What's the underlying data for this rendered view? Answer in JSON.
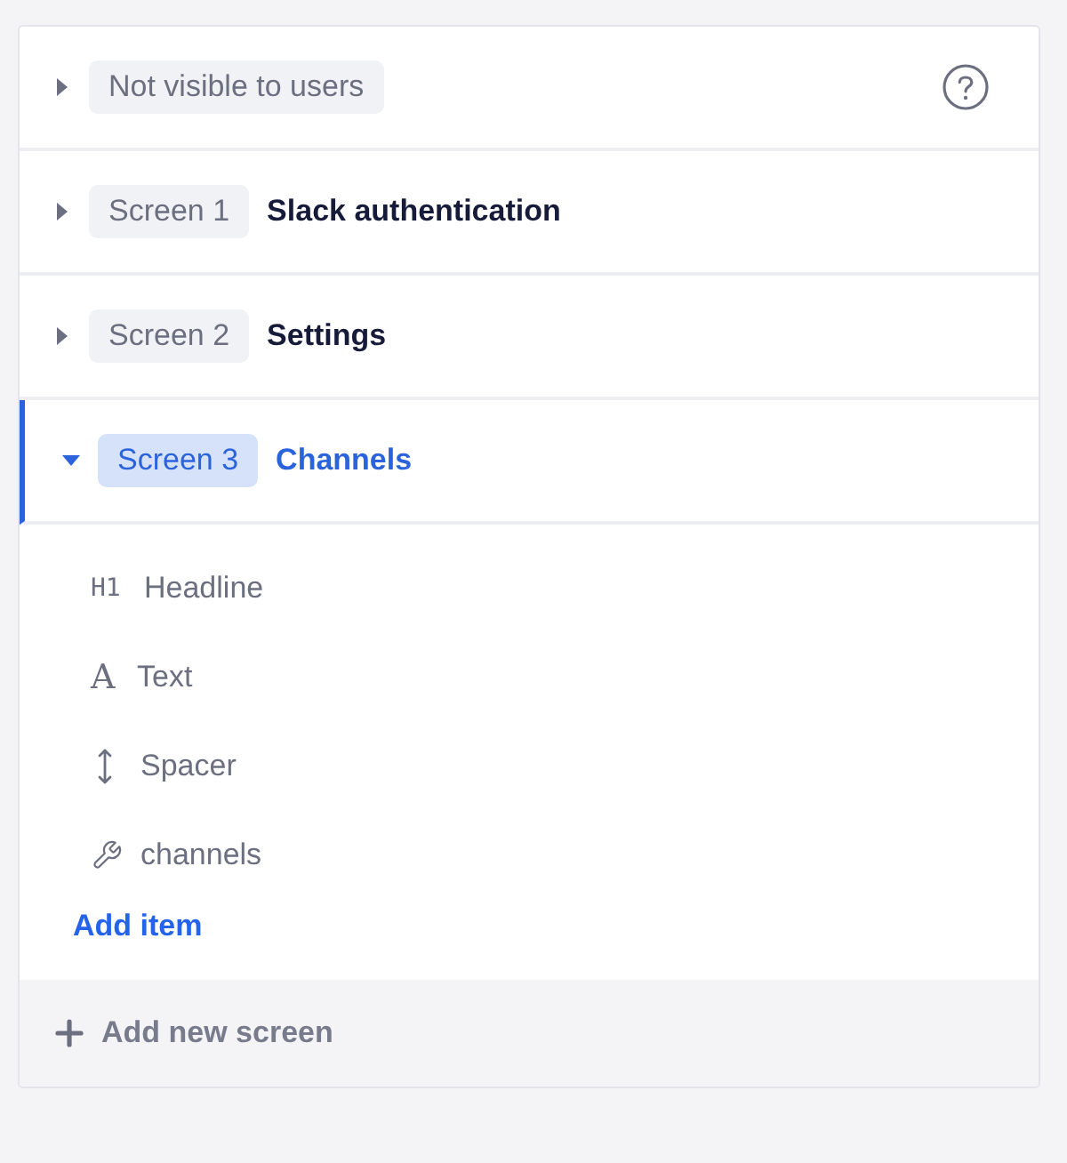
{
  "screens": [
    {
      "kind": "hidden",
      "badge": "Not visible to users",
      "selected": false,
      "expanded": false
    },
    {
      "kind": "screen",
      "badge": "Screen 1",
      "title": "Slack authentication",
      "selected": false,
      "expanded": false
    },
    {
      "kind": "screen",
      "badge": "Screen 2",
      "title": "Settings",
      "selected": false,
      "expanded": false
    },
    {
      "kind": "screen",
      "badge": "Screen 3",
      "title": "Channels",
      "selected": true,
      "expanded": true,
      "items": [
        {
          "kind": "heading",
          "glyph": "H1",
          "label": "Headline"
        },
        {
          "kind": "text",
          "glyph": "A",
          "label": "Text"
        },
        {
          "kind": "spacer",
          "label": "Spacer"
        },
        {
          "kind": "component",
          "label": "channels"
        }
      ],
      "add_item": "Add item"
    }
  ],
  "add_screen": "Add new screen"
}
